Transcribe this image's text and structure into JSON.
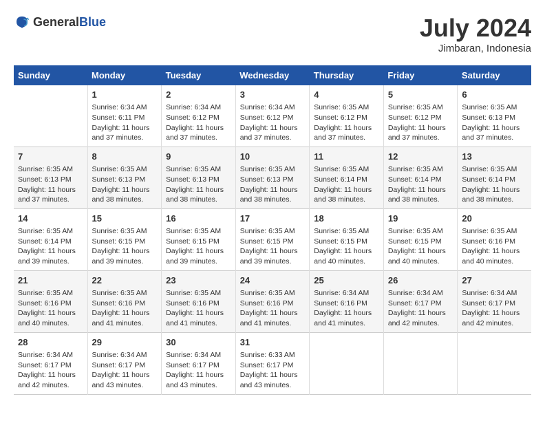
{
  "header": {
    "logo_general": "General",
    "logo_blue": "Blue",
    "month_year": "July 2024",
    "location": "Jimbaran, Indonesia"
  },
  "days_of_week": [
    "Sunday",
    "Monday",
    "Tuesday",
    "Wednesday",
    "Thursday",
    "Friday",
    "Saturday"
  ],
  "weeks": [
    [
      {
        "day": "",
        "info": ""
      },
      {
        "day": "1",
        "info": "Sunrise: 6:34 AM\nSunset: 6:11 PM\nDaylight: 11 hours\nand 37 minutes."
      },
      {
        "day": "2",
        "info": "Sunrise: 6:34 AM\nSunset: 6:12 PM\nDaylight: 11 hours\nand 37 minutes."
      },
      {
        "day": "3",
        "info": "Sunrise: 6:34 AM\nSunset: 6:12 PM\nDaylight: 11 hours\nand 37 minutes."
      },
      {
        "day": "4",
        "info": "Sunrise: 6:35 AM\nSunset: 6:12 PM\nDaylight: 11 hours\nand 37 minutes."
      },
      {
        "day": "5",
        "info": "Sunrise: 6:35 AM\nSunset: 6:12 PM\nDaylight: 11 hours\nand 37 minutes."
      },
      {
        "day": "6",
        "info": "Sunrise: 6:35 AM\nSunset: 6:13 PM\nDaylight: 11 hours\nand 37 minutes."
      }
    ],
    [
      {
        "day": "7",
        "info": "Sunrise: 6:35 AM\nSunset: 6:13 PM\nDaylight: 11 hours\nand 37 minutes."
      },
      {
        "day": "8",
        "info": "Sunrise: 6:35 AM\nSunset: 6:13 PM\nDaylight: 11 hours\nand 38 minutes."
      },
      {
        "day": "9",
        "info": "Sunrise: 6:35 AM\nSunset: 6:13 PM\nDaylight: 11 hours\nand 38 minutes."
      },
      {
        "day": "10",
        "info": "Sunrise: 6:35 AM\nSunset: 6:13 PM\nDaylight: 11 hours\nand 38 minutes."
      },
      {
        "day": "11",
        "info": "Sunrise: 6:35 AM\nSunset: 6:14 PM\nDaylight: 11 hours\nand 38 minutes."
      },
      {
        "day": "12",
        "info": "Sunrise: 6:35 AM\nSunset: 6:14 PM\nDaylight: 11 hours\nand 38 minutes."
      },
      {
        "day": "13",
        "info": "Sunrise: 6:35 AM\nSunset: 6:14 PM\nDaylight: 11 hours\nand 38 minutes."
      }
    ],
    [
      {
        "day": "14",
        "info": "Sunrise: 6:35 AM\nSunset: 6:14 PM\nDaylight: 11 hours\nand 39 minutes."
      },
      {
        "day": "15",
        "info": "Sunrise: 6:35 AM\nSunset: 6:15 PM\nDaylight: 11 hours\nand 39 minutes."
      },
      {
        "day": "16",
        "info": "Sunrise: 6:35 AM\nSunset: 6:15 PM\nDaylight: 11 hours\nand 39 minutes."
      },
      {
        "day": "17",
        "info": "Sunrise: 6:35 AM\nSunset: 6:15 PM\nDaylight: 11 hours\nand 39 minutes."
      },
      {
        "day": "18",
        "info": "Sunrise: 6:35 AM\nSunset: 6:15 PM\nDaylight: 11 hours\nand 40 minutes."
      },
      {
        "day": "19",
        "info": "Sunrise: 6:35 AM\nSunset: 6:15 PM\nDaylight: 11 hours\nand 40 minutes."
      },
      {
        "day": "20",
        "info": "Sunrise: 6:35 AM\nSunset: 6:16 PM\nDaylight: 11 hours\nand 40 minutes."
      }
    ],
    [
      {
        "day": "21",
        "info": "Sunrise: 6:35 AM\nSunset: 6:16 PM\nDaylight: 11 hours\nand 40 minutes."
      },
      {
        "day": "22",
        "info": "Sunrise: 6:35 AM\nSunset: 6:16 PM\nDaylight: 11 hours\nand 41 minutes."
      },
      {
        "day": "23",
        "info": "Sunrise: 6:35 AM\nSunset: 6:16 PM\nDaylight: 11 hours\nand 41 minutes."
      },
      {
        "day": "24",
        "info": "Sunrise: 6:35 AM\nSunset: 6:16 PM\nDaylight: 11 hours\nand 41 minutes."
      },
      {
        "day": "25",
        "info": "Sunrise: 6:34 AM\nSunset: 6:16 PM\nDaylight: 11 hours\nand 41 minutes."
      },
      {
        "day": "26",
        "info": "Sunrise: 6:34 AM\nSunset: 6:17 PM\nDaylight: 11 hours\nand 42 minutes."
      },
      {
        "day": "27",
        "info": "Sunrise: 6:34 AM\nSunset: 6:17 PM\nDaylight: 11 hours\nand 42 minutes."
      }
    ],
    [
      {
        "day": "28",
        "info": "Sunrise: 6:34 AM\nSunset: 6:17 PM\nDaylight: 11 hours\nand 42 minutes."
      },
      {
        "day": "29",
        "info": "Sunrise: 6:34 AM\nSunset: 6:17 PM\nDaylight: 11 hours\nand 43 minutes."
      },
      {
        "day": "30",
        "info": "Sunrise: 6:34 AM\nSunset: 6:17 PM\nDaylight: 11 hours\nand 43 minutes."
      },
      {
        "day": "31",
        "info": "Sunrise: 6:33 AM\nSunset: 6:17 PM\nDaylight: 11 hours\nand 43 minutes."
      },
      {
        "day": "",
        "info": ""
      },
      {
        "day": "",
        "info": ""
      },
      {
        "day": "",
        "info": ""
      }
    ]
  ]
}
